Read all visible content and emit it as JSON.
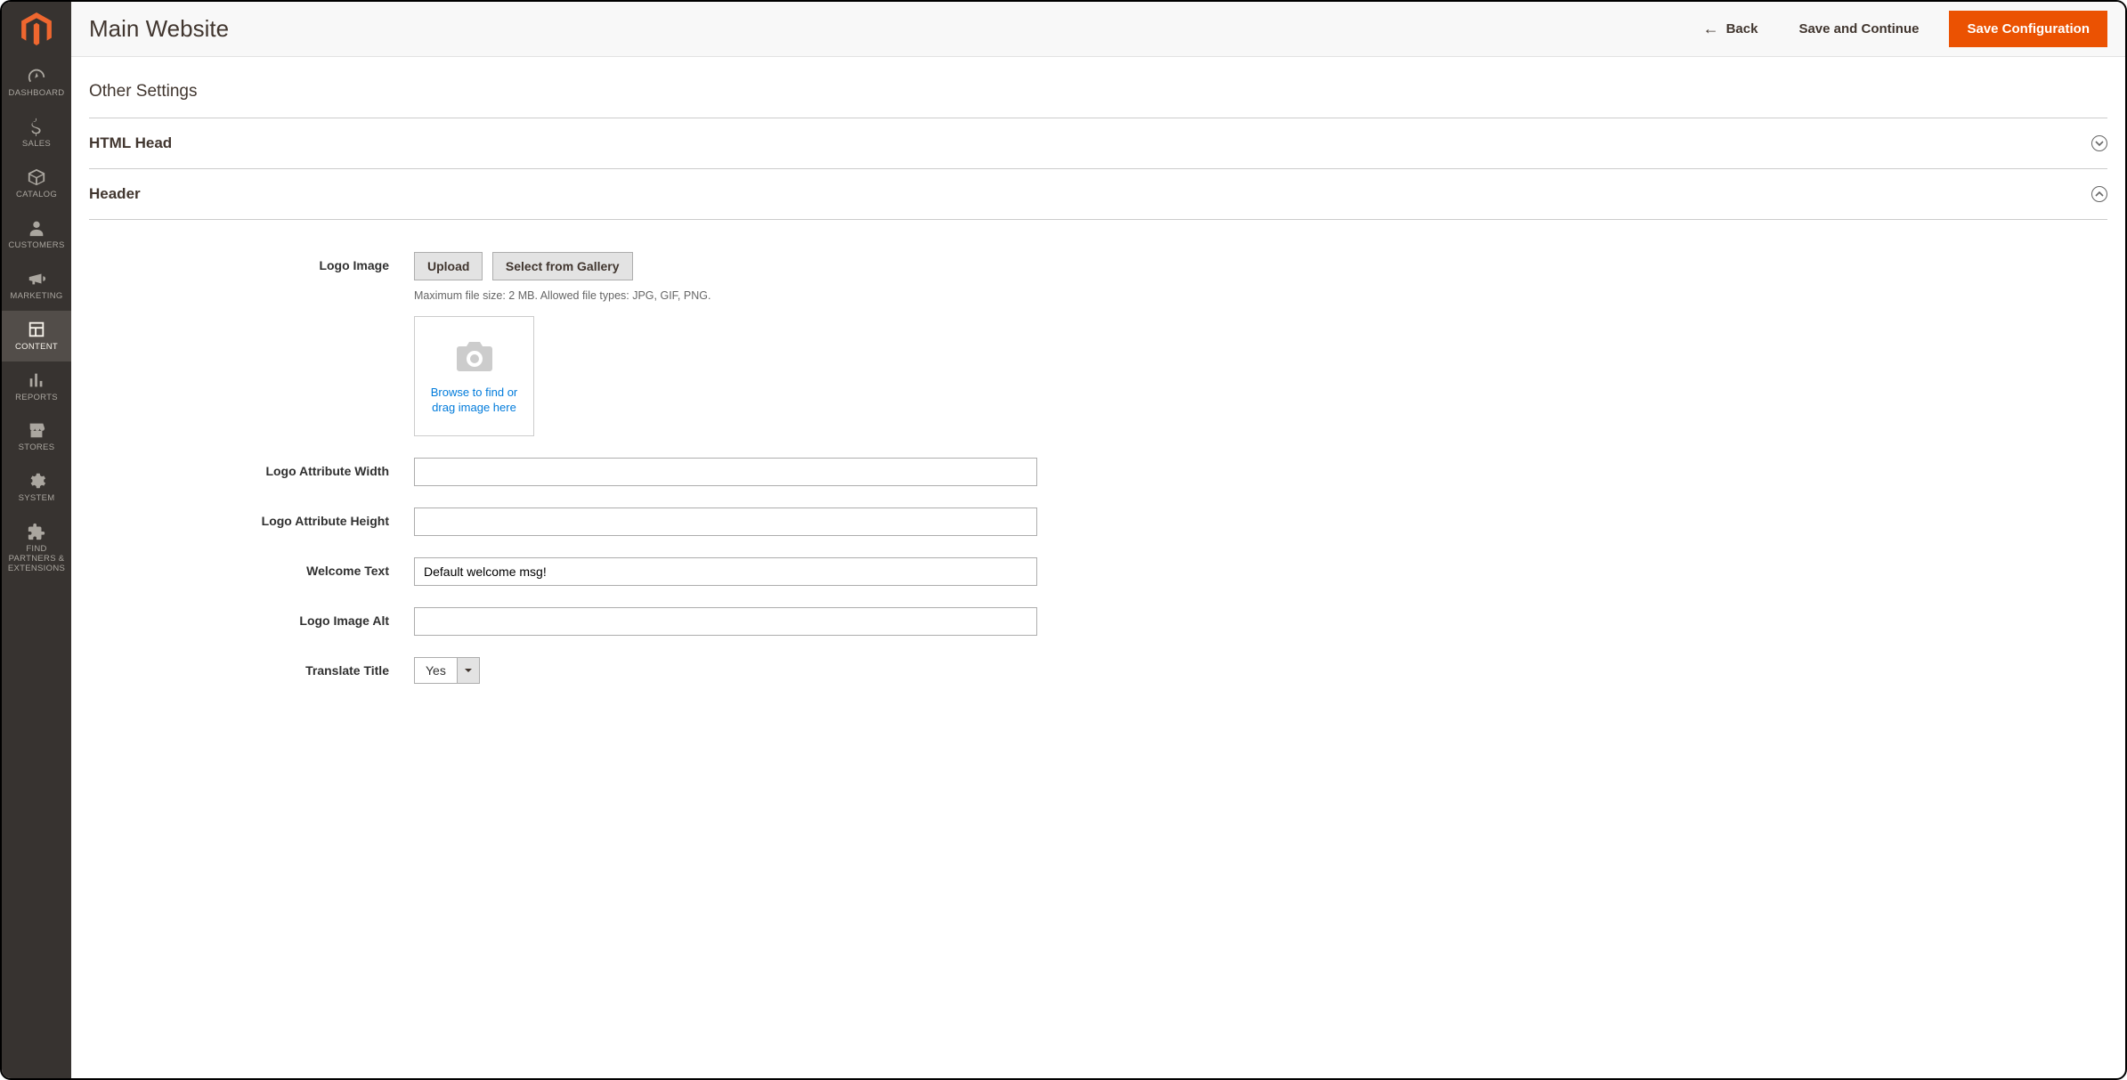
{
  "sidebar": {
    "items": [
      {
        "label": "DASHBOARD"
      },
      {
        "label": "SALES"
      },
      {
        "label": "CATALOG"
      },
      {
        "label": "CUSTOMERS"
      },
      {
        "label": "MARKETING"
      },
      {
        "label": "CONTENT"
      },
      {
        "label": "REPORTS"
      },
      {
        "label": "STORES"
      },
      {
        "label": "SYSTEM"
      },
      {
        "label": "FIND PARTNERS & EXTENSIONS"
      }
    ]
  },
  "header": {
    "page_title": "Main Website",
    "back_label": "Back",
    "save_continue_label": "Save and Continue",
    "save_config_label": "Save Configuration"
  },
  "sections": {
    "other_settings": "Other Settings",
    "html_head": "HTML Head",
    "header": "Header"
  },
  "form": {
    "logo_image_label": "Logo Image",
    "upload_btn": "Upload",
    "gallery_btn": "Select from Gallery",
    "upload_note": "Maximum file size: 2 MB. Allowed file types: JPG, GIF, PNG.",
    "dropzone_text": "Browse to find or drag image here",
    "logo_width_label": "Logo Attribute Width",
    "logo_width_value": "",
    "logo_height_label": "Logo Attribute Height",
    "logo_height_value": "",
    "welcome_text_label": "Welcome Text",
    "welcome_text_value": "Default welcome msg!",
    "logo_alt_label": "Logo Image Alt",
    "logo_alt_value": "",
    "translate_title_label": "Translate Title",
    "translate_title_value": "Yes"
  }
}
